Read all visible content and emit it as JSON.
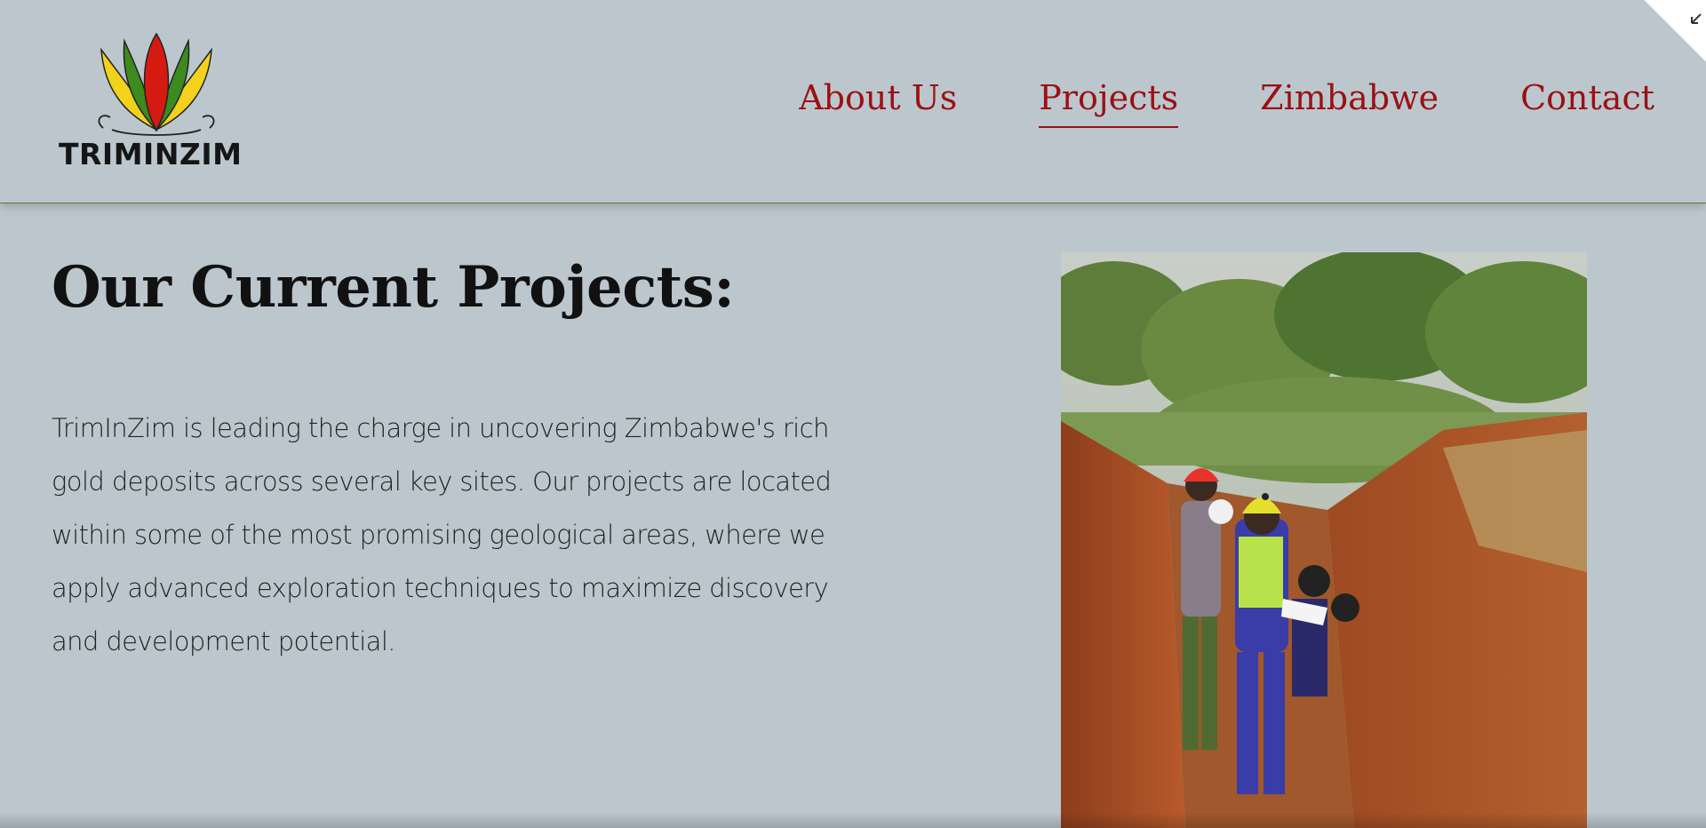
{
  "brand": {
    "name": "TRIMINZIM",
    "colors": {
      "yellow": "#f2d21a",
      "green": "#3d8a1e",
      "red": "#d51a12"
    }
  },
  "nav": {
    "items": [
      {
        "label": "About Us",
        "active": false
      },
      {
        "label": "Projects",
        "active": true
      },
      {
        "label": "Zimbabwe",
        "active": false
      },
      {
        "label": "Contact",
        "active": false
      }
    ],
    "color": "#9b1014"
  },
  "main": {
    "title": "Our Current Projects:",
    "description": "TrimInZim is leading the charge in uncovering Zimbabwe's rich gold deposits across several key sites. Our projects are located within some of the most promising geological areas, where we apply advanced exploration techniques to maximize discovery and development potential."
  },
  "icons": {
    "corner": "collapse-arrow-icon"
  }
}
